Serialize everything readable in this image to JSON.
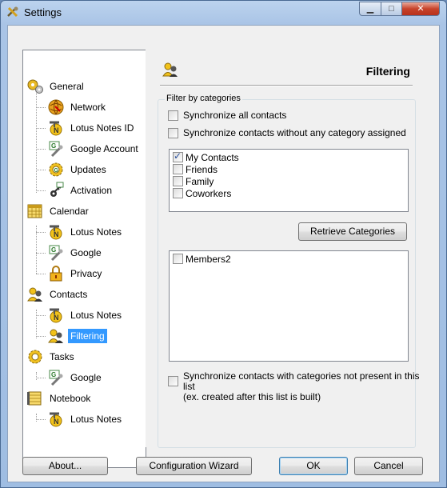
{
  "window": {
    "title": "Settings"
  },
  "caption": {
    "minimize": "▁",
    "maximize": "□",
    "close": "✕"
  },
  "tree": {
    "items": [
      {
        "label": "General",
        "icon": "gears-icon"
      },
      {
        "label": "Network",
        "icon": "globe-icon"
      },
      {
        "label": "Lotus Notes ID",
        "icon": "lotus-notes-icon"
      },
      {
        "label": "Google Account",
        "icon": "google-icon"
      },
      {
        "label": "Updates",
        "icon": "update-gear-icon"
      },
      {
        "label": "Activation",
        "icon": "key-icon"
      },
      {
        "label": "Calendar",
        "icon": "calendar-icon"
      },
      {
        "label": "Lotus Notes",
        "icon": "lotus-notes-icon"
      },
      {
        "label": "Google",
        "icon": "google-icon"
      },
      {
        "label": "Privacy",
        "icon": "lock-icon"
      },
      {
        "label": "Contacts",
        "icon": "contacts-icon"
      },
      {
        "label": "Lotus Notes",
        "icon": "lotus-notes-icon"
      },
      {
        "label": "Filtering",
        "icon": "contacts-icon"
      },
      {
        "label": "Tasks",
        "icon": "tasks-gear-icon"
      },
      {
        "label": "Google",
        "icon": "google-icon"
      },
      {
        "label": "Notebook",
        "icon": "notebook-icon"
      },
      {
        "label": "Lotus Notes",
        "icon": "lotus-notes-icon"
      }
    ],
    "selected": "Filtering"
  },
  "panel": {
    "title": "Filtering",
    "group_label": "Filter by categories",
    "sync_all": {
      "label": "Synchronize all contacts",
      "checked": false
    },
    "sync_no_category": {
      "label": "Synchronize contacts without any category assigned",
      "checked": false
    },
    "categories": [
      {
        "label": "My Contacts",
        "checked": true
      },
      {
        "label": "Friends",
        "checked": false
      },
      {
        "label": "Family",
        "checked": false
      },
      {
        "label": "Coworkers",
        "checked": false
      }
    ],
    "retrieve_button": "Retrieve Categories",
    "server_categories": [
      {
        "label": "Members2",
        "checked": false
      }
    ],
    "sync_not_present": {
      "line1": "Synchronize contacts with categories not present in this list",
      "line2": "(ex. created after this list is built)",
      "checked": false
    }
  },
  "buttons": {
    "about": "About...",
    "wizard": "Configuration Wizard",
    "ok": "OK",
    "cancel": "Cancel"
  }
}
